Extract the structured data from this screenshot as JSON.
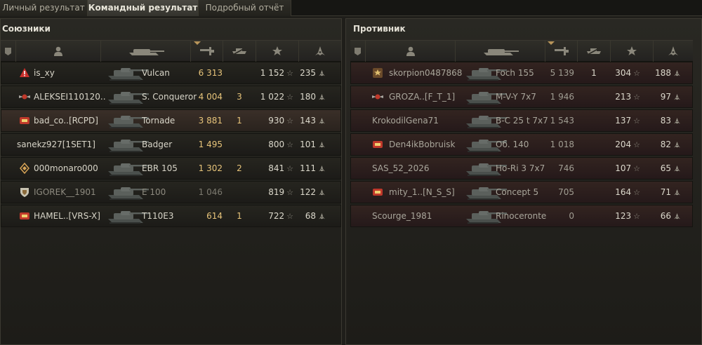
{
  "tabs": [
    "Личный результат",
    "Командный результат",
    "Подробный отчёт"
  ],
  "active_tab": 1,
  "allies": {
    "title": "Союзники",
    "rows": [
      {
        "name": "is_xy",
        "vehicle": "Vulcan",
        "damage": "6 313",
        "frags": "",
        "xp": "1 152",
        "rank": "235",
        "badge": "warning-badge",
        "dead": false
      },
      {
        "name": "ALEKSEI110120..",
        "vehicle": "S. Conqueror",
        "damage": "4 004",
        "frags": "3",
        "xp": "1 022",
        "rank": "180",
        "badge": "wings-badge",
        "dead": false
      },
      {
        "name": "bad_co..[RCPD]",
        "vehicle": "Tornade",
        "damage": "3 881",
        "frags": "1",
        "xp": "930",
        "rank": "143",
        "badge": "clan-badge",
        "dead": false
      },
      {
        "name": "sanekz927[1SET1]",
        "vehicle": "Badger",
        "damage": "1 495",
        "frags": "",
        "xp": "800",
        "rank": "101",
        "badge": "",
        "dead": false
      },
      {
        "name": "000monaro000",
        "vehicle": "EBR 105",
        "damage": "1 302",
        "frags": "2",
        "xp": "841",
        "rank": "111",
        "badge": "diamond-badge",
        "dead": false
      },
      {
        "name": "IGOREK__1901",
        "vehicle": "E 100",
        "damage": "1 046",
        "frags": "",
        "xp": "819",
        "rank": "122",
        "badge": "shield-badge",
        "dead": true
      },
      {
        "name": "HAMEL..[VRS-X]",
        "vehicle": "T110E3",
        "damage": "614",
        "frags": "1",
        "xp": "722",
        "rank": "68",
        "badge": "clan-badge",
        "dead": false
      }
    ]
  },
  "enemies": {
    "title": "Противник",
    "rows": [
      {
        "name": "skorpion0487868",
        "vehicle": "Foch 155",
        "damage": "5 139",
        "frags": "1",
        "xp": "304",
        "rank": "188",
        "badge": "star-badge"
      },
      {
        "name": "GROZA..[F_T_1]",
        "vehicle": "M-V-Y 7x7",
        "damage": "1 946",
        "frags": "",
        "xp": "213",
        "rank": "97",
        "badge": "wings-badge"
      },
      {
        "name": "KrokodilGena71",
        "vehicle": "B-C 25 t 7x7",
        "damage": "1 543",
        "frags": "",
        "xp": "137",
        "rank": "83",
        "badge": ""
      },
      {
        "name": "Den4ikBobruisk",
        "vehicle": "Об. 140",
        "damage": "1 018",
        "frags": "",
        "xp": "204",
        "rank": "82",
        "badge": "clan-badge"
      },
      {
        "name": "SAS_52_2026",
        "vehicle": "Ho-Ri 3 7x7",
        "damage": "746",
        "frags": "",
        "xp": "107",
        "rank": "65",
        "badge": ""
      },
      {
        "name": "mity_1..[N_S_S]",
        "vehicle": "Concept 5",
        "damage": "705",
        "frags": "",
        "xp": "164",
        "rank": "71",
        "badge": "clan-badge"
      },
      {
        "name": "Scourge_1981",
        "vehicle": "Rinoceronte",
        "damage": "0",
        "frags": "",
        "xp": "123",
        "rank": "66",
        "badge": ""
      }
    ]
  },
  "colors": {
    "damage": "#e7c47a",
    "text": "#d8d5c8",
    "enemy_bg": "#2e201d",
    "ally_bg": "#23221d"
  }
}
